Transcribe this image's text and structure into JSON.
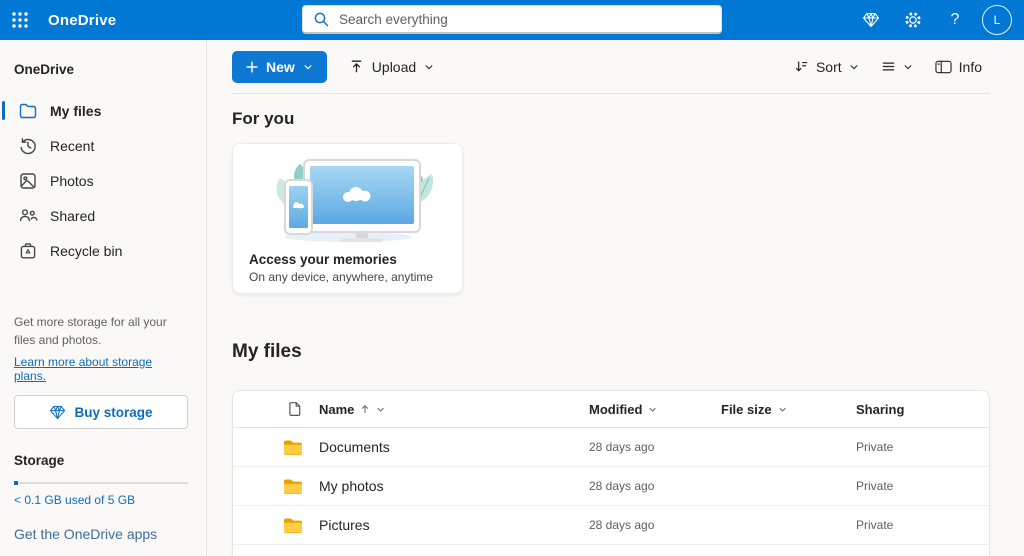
{
  "colors": {
    "header_blue": "#0078d4",
    "accent_blue": "#0f6cbd",
    "folder_yellow": "#ffcd43"
  },
  "header": {
    "app_title": "OneDrive",
    "search_placeholder": "Search everything",
    "avatar_initial": "L"
  },
  "sidebar": {
    "section_label": "OneDrive",
    "nav": [
      {
        "label": "My files"
      },
      {
        "label": "Recent"
      },
      {
        "label": "Photos"
      },
      {
        "label": "Shared"
      },
      {
        "label": "Recycle bin"
      }
    ],
    "promo_text": "Get more storage for all your files and photos.",
    "promo_link": "Learn more about storage plans.",
    "buy_storage_label": "Buy storage",
    "storage_heading": "Storage",
    "storage_usage": "< 0.1 GB used of 5 GB",
    "apps_link": "Get the OneDrive apps"
  },
  "toolbar": {
    "new_label": "New",
    "upload_label": "Upload",
    "sort_label": "Sort",
    "info_label": "Info"
  },
  "for_you": {
    "heading": "For you",
    "card_title": "Access your memories",
    "card_subtitle": "On any device, anywhere, anytime"
  },
  "my_files": {
    "heading": "My files",
    "columns": [
      "Name",
      "Modified",
      "File size",
      "Sharing"
    ],
    "rows": [
      {
        "name": "Documents",
        "modified": "28 days ago",
        "file_size": "",
        "sharing": "Private"
      },
      {
        "name": "My photos",
        "modified": "28 days ago",
        "file_size": "",
        "sharing": "Private"
      },
      {
        "name": "Pictures",
        "modified": "28 days ago",
        "file_size": "",
        "sharing": "Private"
      }
    ]
  }
}
